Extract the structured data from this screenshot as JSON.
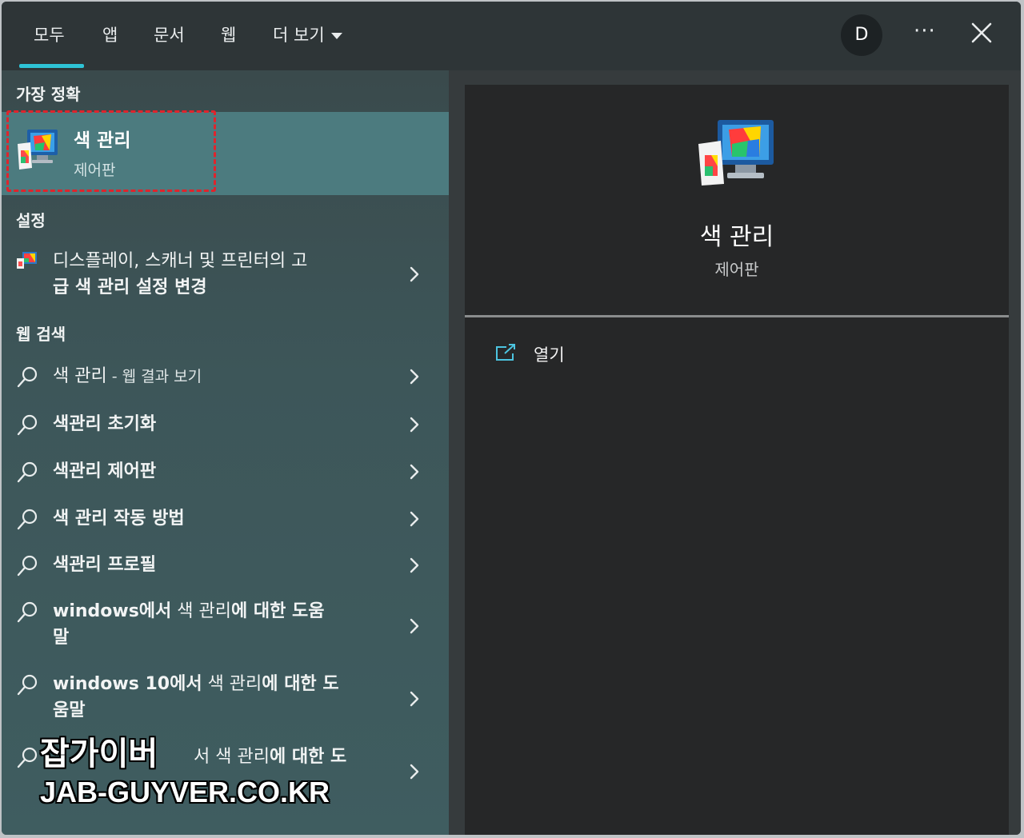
{
  "tabs": [
    {
      "label": "모두",
      "active": true
    },
    {
      "label": "앱"
    },
    {
      "label": "문서"
    },
    {
      "label": "웹"
    },
    {
      "label": "더 보기"
    }
  ],
  "header": {
    "avatar_initial": "D",
    "more_label": "···"
  },
  "sections": {
    "best_match": "가장 정확",
    "settings": "설정",
    "web_search": "웹 검색"
  },
  "best_match": {
    "title": "색 관리",
    "subtitle": "제어판"
  },
  "settings_items": [
    {
      "line1": "디스플레이, 스캐너 및 프린터의 고",
      "line2": "급 색 관리 설정 변경"
    }
  ],
  "web_results": [
    {
      "bold": "색 관리",
      "suffix": " - 웹 결과 보기"
    },
    {
      "bold": "색관리 초기화"
    },
    {
      "bold": "색관리 제어판"
    },
    {
      "bold": "색 관리 작동 방법"
    },
    {
      "bold": "색관리 프로필"
    },
    {
      "line1_bold": "windows에서",
      "line1_light": " 색 관리",
      "line1_bold2": "에 대한 도움",
      "line2": "말"
    },
    {
      "line1_bold": "windows 10에서",
      "line1_light": " 색 관리",
      "line1_bold2": "에 대한 도",
      "line2": "움말"
    },
    {
      "line1_bold": "",
      "line1_light": "서 색 관리",
      "line1_bold2": "에 대한 도",
      "line2": ""
    }
  ],
  "watermark": {
    "line1": "잡가이버",
    "line2": "JAB-GUYVER.CO.KR"
  },
  "detail": {
    "title": "색 관리",
    "subtitle": "제어판",
    "open_label": "열기"
  },
  "colors": {
    "accent": "#2ec3d6",
    "selected_row": "#4c7b7f",
    "highlight": "#e0242c"
  }
}
